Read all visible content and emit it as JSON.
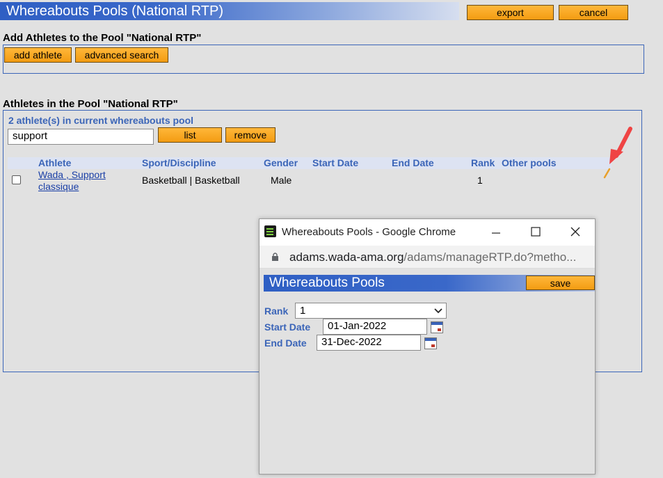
{
  "page": {
    "title": "Whereabouts Pools (National RTP)",
    "export_label": "export",
    "cancel_label": "cancel"
  },
  "add_section": {
    "title": "Add Athletes to the Pool \"National RTP\"",
    "add_athlete_label": "add athlete",
    "advanced_search_label": "advanced search"
  },
  "pool_section": {
    "title": "Athletes in the Pool \"National RTP\"",
    "count_text": "2 athlete(s) in current whereabouts pool",
    "search_value": "support",
    "list_label": "list",
    "remove_label": "remove",
    "columns": [
      "Athlete",
      "Sport/Discipline",
      "Gender",
      "Start Date",
      "End Date",
      "Rank",
      "Other pools"
    ],
    "rows": [
      {
        "athlete_line1": "Wada , Support",
        "athlete_line2": "classique",
        "sport": "Basketball | Basketball",
        "gender": "Male",
        "start_date": "",
        "end_date": "",
        "rank": "1"
      }
    ]
  },
  "popup": {
    "window_title": "Whereabouts Pools - Google Chrome",
    "url_host": "adams.wada-ama.org",
    "url_path": "/adams/manageRTP.do?metho...",
    "header": "Whereabouts Pools",
    "save_label": "save",
    "rank_label": "Rank",
    "rank_value": "1",
    "start_label": "Start Date",
    "start_value": "01-Jan-2022",
    "end_label": "End Date",
    "end_value": "31-Dec-2022"
  },
  "colors": {
    "accent_blue": "#3b65b8",
    "button_orange": "#f5a623",
    "annotation_arrow": "#ef4444"
  },
  "icons": {
    "edit": "pencil-icon",
    "calendar": "calendar-icon",
    "lock": "lock-icon",
    "app": "app-logo-icon"
  }
}
